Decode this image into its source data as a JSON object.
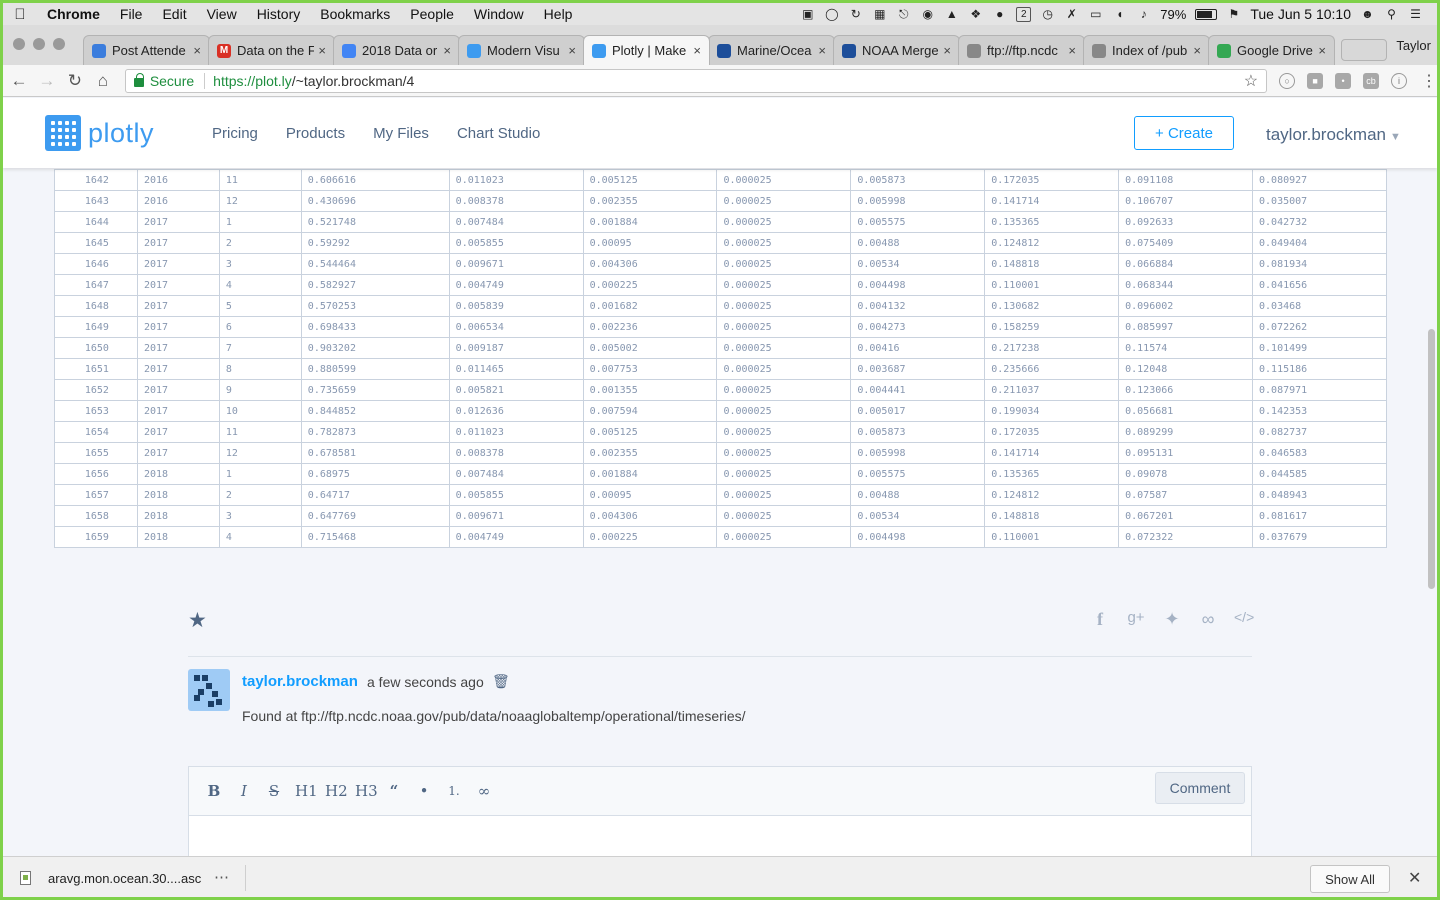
{
  "menubar": {
    "app": "Chrome",
    "items": [
      "File",
      "Edit",
      "View",
      "History",
      "Bookmarks",
      "People",
      "Window",
      "Help"
    ],
    "badge": "2",
    "battery": "79%",
    "clock": "Tue Jun 5  10:10"
  },
  "tabs": [
    {
      "title": "Post Attende",
      "fav": "#3b7ddd",
      "glyph": ""
    },
    {
      "title": "Data on the F",
      "fav": "#d93025",
      "glyph": "M"
    },
    {
      "title": "2018 Data or",
      "fav": "#4285f4",
      "glyph": ""
    },
    {
      "title": "Modern Visu",
      "fav": "#3d9bf0",
      "glyph": ""
    },
    {
      "title": "Plotly | Make",
      "fav": "#3d9bf0",
      "glyph": ""
    },
    {
      "title": "Marine/Ocea",
      "fav": "#1d4e9a",
      "glyph": ""
    },
    {
      "title": "NOAA Merge",
      "fav": "#1d4e9a",
      "glyph": ""
    },
    {
      "title": "ftp://ftp.ncdc",
      "fav": "#888888",
      "glyph": ""
    },
    {
      "title": "Index of /pub",
      "fav": "#888888",
      "glyph": ""
    },
    {
      "title": "Google Drive",
      "fav": "#34a853",
      "glyph": ""
    }
  ],
  "active_tab": 4,
  "profile": "Taylor",
  "address": {
    "secure_label": "Secure",
    "url_host": "https://plot.ly",
    "url_path": "/~taylor.brockman/4"
  },
  "plotly": {
    "brand": "plotly",
    "nav": [
      "Pricing",
      "Products",
      "My Files",
      "Chart Studio"
    ],
    "create_label": "+ Create",
    "username": "taylor.brockman"
  },
  "table": {
    "rows": [
      [
        "1642",
        "2016",
        "11",
        "0.606616",
        "0.011023",
        "0.005125",
        "0.000025",
        "0.005873",
        "0.172035",
        "0.091108",
        "0.080927"
      ],
      [
        "1643",
        "2016",
        "12",
        "0.430696",
        "0.008378",
        "0.002355",
        "0.000025",
        "0.005998",
        "0.141714",
        "0.106707",
        "0.035007"
      ],
      [
        "1644",
        "2017",
        "1",
        "0.521748",
        "0.007484",
        "0.001884",
        "0.000025",
        "0.005575",
        "0.135365",
        "0.092633",
        "0.042732"
      ],
      [
        "1645",
        "2017",
        "2",
        "0.59292",
        "0.005855",
        "0.00095",
        "0.000025",
        "0.00488",
        "0.124812",
        "0.075409",
        "0.049404"
      ],
      [
        "1646",
        "2017",
        "3",
        "0.544464",
        "0.009671",
        "0.004306",
        "0.000025",
        "0.00534",
        "0.148818",
        "0.066884",
        "0.081934"
      ],
      [
        "1647",
        "2017",
        "4",
        "0.582927",
        "0.004749",
        "0.000225",
        "0.000025",
        "0.004498",
        "0.110001",
        "0.068344",
        "0.041656"
      ],
      [
        "1648",
        "2017",
        "5",
        "0.570253",
        "0.005839",
        "0.001682",
        "0.000025",
        "0.004132",
        "0.130682",
        "0.096002",
        "0.03468"
      ],
      [
        "1649",
        "2017",
        "6",
        "0.698433",
        "0.006534",
        "0.002236",
        "0.000025",
        "0.004273",
        "0.158259",
        "0.085997",
        "0.072262"
      ],
      [
        "1650",
        "2017",
        "7",
        "0.903202",
        "0.009187",
        "0.005002",
        "0.000025",
        "0.00416",
        "0.217238",
        "0.11574",
        "0.101499"
      ],
      [
        "1651",
        "2017",
        "8",
        "0.880599",
        "0.011465",
        "0.007753",
        "0.000025",
        "0.003687",
        "0.235666",
        "0.12048",
        "0.115186"
      ],
      [
        "1652",
        "2017",
        "9",
        "0.735659",
        "0.005821",
        "0.001355",
        "0.000025",
        "0.004441",
        "0.211037",
        "0.123066",
        "0.087971"
      ],
      [
        "1653",
        "2017",
        "10",
        "0.844852",
        "0.012636",
        "0.007594",
        "0.000025",
        "0.005017",
        "0.199034",
        "0.056681",
        "0.142353"
      ],
      [
        "1654",
        "2017",
        "11",
        "0.782873",
        "0.011023",
        "0.005125",
        "0.000025",
        "0.005873",
        "0.172035",
        "0.089299",
        "0.082737"
      ],
      [
        "1655",
        "2017",
        "12",
        "0.678581",
        "0.008378",
        "0.002355",
        "0.000025",
        "0.005998",
        "0.141714",
        "0.095131",
        "0.046583"
      ],
      [
        "1656",
        "2018",
        "1",
        "0.68975",
        "0.007484",
        "0.001884",
        "0.000025",
        "0.005575",
        "0.135365",
        "0.09078",
        "0.044585"
      ],
      [
        "1657",
        "2018",
        "2",
        "0.64717",
        "0.005855",
        "0.00095",
        "0.000025",
        "0.00488",
        "0.124812",
        "0.07587",
        "0.048943"
      ],
      [
        "1658",
        "2018",
        "3",
        "0.647769",
        "0.009671",
        "0.004306",
        "0.000025",
        "0.00534",
        "0.148818",
        "0.067201",
        "0.081617"
      ],
      [
        "1659",
        "2018",
        "4",
        "0.715468",
        "0.004749",
        "0.000225",
        "0.000025",
        "0.004498",
        "0.110001",
        "0.072322",
        "0.037679"
      ]
    ]
  },
  "comment": {
    "user": "taylor.brockman",
    "time": "a few seconds ago",
    "text": "Found at ftp://ftp.ncdc.noaa.gov/pub/data/noaaglobaltemp/operational/timeseries/"
  },
  "editor": {
    "tools": [
      "B",
      "I",
      "S",
      "H1",
      "H2",
      "H3",
      "“",
      "•",
      "1.",
      "∞"
    ],
    "submit_label": "Comment"
  },
  "download": {
    "filename": "aravg.mon.ocean.30....asc",
    "show_all_label": "Show All"
  }
}
